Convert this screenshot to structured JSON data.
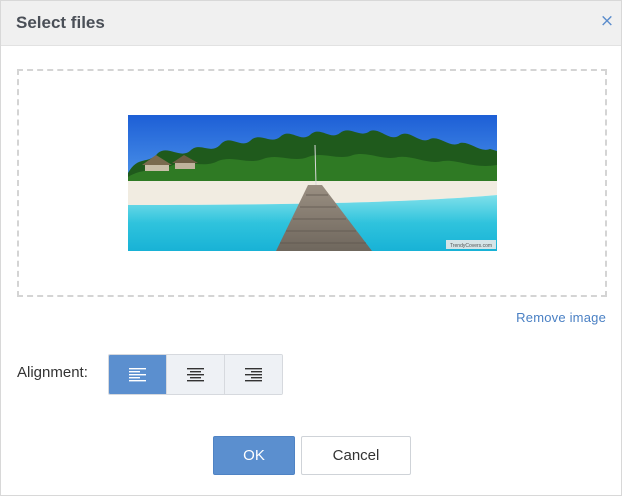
{
  "dialog": {
    "title": "Select files",
    "close_icon": "close-icon",
    "close_glyph": "×"
  },
  "preview": {
    "description_icon": "beach-pier-image",
    "watermark": "TrendyCovers.com"
  },
  "remove_label": "Remove image",
  "alignment": {
    "label": "Alignment:",
    "options": [
      {
        "icon": "align-left-icon",
        "selected": true
      },
      {
        "icon": "align-center-icon",
        "selected": false
      },
      {
        "icon": "align-right-icon",
        "selected": false
      }
    ]
  },
  "buttons": {
    "ok": "OK",
    "cancel": "Cancel"
  },
  "colors": {
    "accent": "#5b8fcf",
    "link": "#4a80c4",
    "header_bg": "#f0f0f0"
  }
}
